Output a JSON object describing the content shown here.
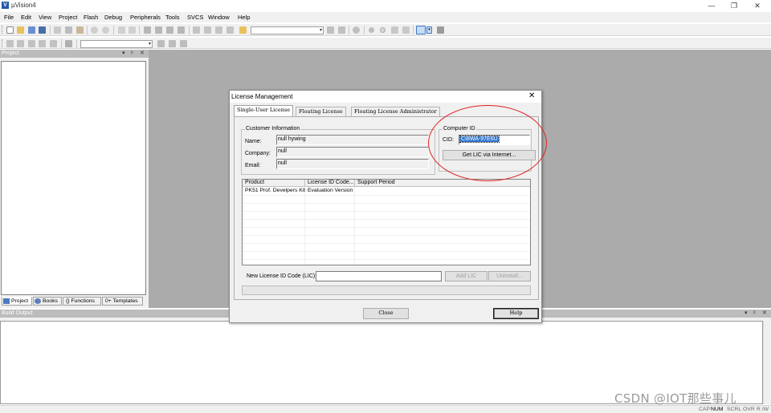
{
  "app": {
    "title": "µVision4",
    "icon_letter": "V"
  },
  "window_controls": [
    "—",
    "❐",
    "✕"
  ],
  "menu": [
    "File",
    "Edit",
    "View",
    "Project",
    "Flash",
    "Debug",
    "Peripherals",
    "Tools",
    "SVCS",
    "Window",
    "Help"
  ],
  "toolbar": {
    "combo1_value": "",
    "combo2_value": ""
  },
  "project_panel": {
    "title": "Project",
    "controls": [
      "▾",
      "ᵖ",
      "✕"
    ],
    "tabs": [
      {
        "label": "Project"
      },
      {
        "label": "Books"
      },
      {
        "label": "Functions",
        "prefix": "{}"
      },
      {
        "label": "Templates",
        "prefix": "0+"
      }
    ]
  },
  "build_output": {
    "title": "Build Output",
    "controls": [
      "▾",
      "ᵖ",
      "✕"
    ]
  },
  "status_bar": [
    "CAP",
    "NUM",
    "SCRL",
    "OVR",
    "R /W"
  ],
  "watermark": "CSDN @IOT那些事儿",
  "dialog": {
    "title": "License Management",
    "close": "✕",
    "tabs": [
      "Single-User License",
      "Floating License",
      "Floating License Administrator"
    ],
    "customer_info": {
      "title": "Customer Information",
      "name_label": "Name:",
      "name_value": "null hywing",
      "company_label": "Company:",
      "company_value": "null",
      "email_label": "Email:",
      "email_value": "null"
    },
    "computer_id": {
      "title": "Computer ID",
      "cid_label": "CID:",
      "cid_value": "CI8WA-97E6U",
      "get_lic_button": "Get LIC via Internet..."
    },
    "license_table": {
      "columns": [
        "Product",
        "License ID Code...",
        "Support Period"
      ],
      "rows": [
        [
          "PK51 Prof. Develpers Kit",
          "Evaluation Version",
          ""
        ]
      ]
    },
    "new_lic_label": "New License ID Code (LIC):",
    "new_lic_value": "",
    "add_lic_button": "Add LIC",
    "uninstall_button": "Uninstall...",
    "close_button": "Close",
    "help_button": "Help"
  },
  "annotation_color": "#e02020"
}
